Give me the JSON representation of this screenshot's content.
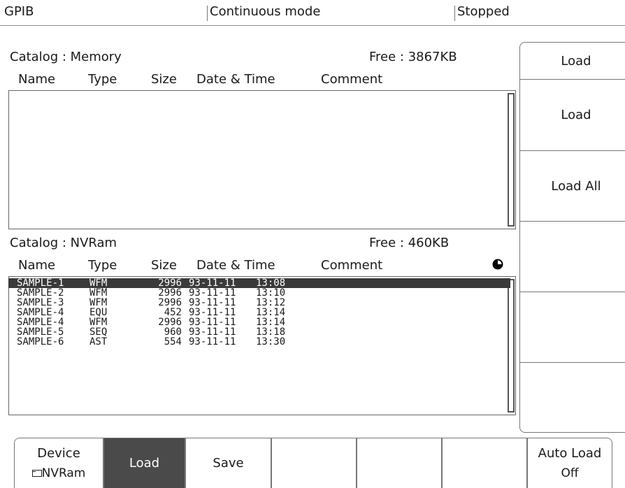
{
  "status": {
    "interface": "GPIB",
    "mode": "Continuous mode",
    "run_state": "Stopped"
  },
  "memory_catalog": {
    "title": "Catalog : Memory",
    "free": "Free : 3867KB",
    "columns": [
      "Name",
      "Type",
      "Size",
      "Date & Time",
      "Comment"
    ],
    "rows": []
  },
  "nvram_catalog": {
    "title": "Catalog : NVRam",
    "free": "Free : 460KB",
    "columns": [
      "Name",
      "Type",
      "Size",
      "Date & Time",
      "Comment"
    ],
    "selected_index": 0,
    "rows": [
      {
        "name": "SAMPLE-1",
        "type": "WFM",
        "size": "2996",
        "date": "93-11-11",
        "time": "13:08",
        "comment": ""
      },
      {
        "name": "SAMPLE-2",
        "type": "WFM",
        "size": "2996",
        "date": "93-11-11",
        "time": "13:10",
        "comment": ""
      },
      {
        "name": "SAMPLE-3",
        "type": "WFM",
        "size": "2996",
        "date": "93-11-11",
        "time": "13:12",
        "comment": ""
      },
      {
        "name": "SAMPLE-4",
        "type": "EQU",
        "size": "452",
        "date": "93-11-11",
        "time": "13:14",
        "comment": ""
      },
      {
        "name": "SAMPLE-4",
        "type": "WFM",
        "size": "2996",
        "date": "93-11-11",
        "time": "13:14",
        "comment": ""
      },
      {
        "name": "SAMPLE-5",
        "type": "SEQ",
        "size": "960",
        "date": "93-11-11",
        "time": "13:18",
        "comment": ""
      },
      {
        "name": "SAMPLE-6",
        "type": "AST",
        "size": "554",
        "date": "93-11-11",
        "time": "13:30",
        "comment": ""
      }
    ]
  },
  "side_menu": {
    "title": "Load",
    "buttons": [
      "Load",
      "Load All",
      "",
      "",
      ""
    ]
  },
  "bottom_menu": {
    "device_label": "Device",
    "device_value": "NVRam",
    "load": "Load",
    "save": "Save",
    "empty": [
      "",
      "",
      ""
    ],
    "auto_load_label": "Auto Load",
    "auto_load_value": "Off"
  },
  "icons": {
    "busy_indicator": "circle-half-icon",
    "device_glyph": "folder-icon"
  }
}
